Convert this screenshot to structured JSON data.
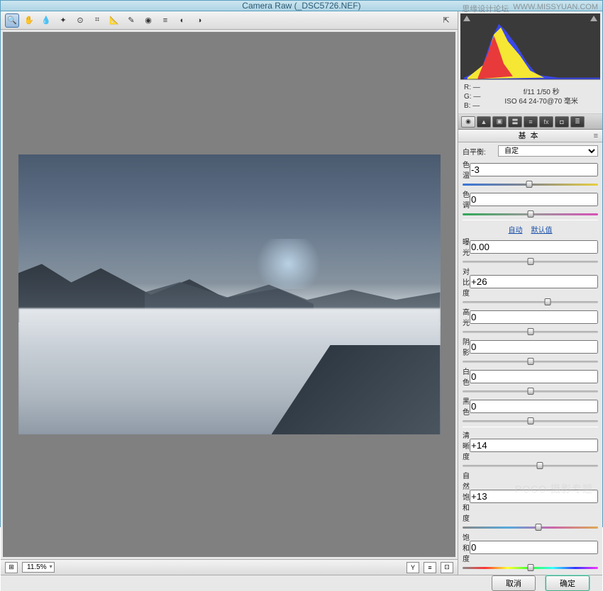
{
  "window": {
    "title": "Camera Raw (_DSC5726.NEF)"
  },
  "watermark": {
    "left": "思缘设计论坛",
    "right": "WWW.MISSYUAN.COM",
    "poco": "POCO 摄影专题"
  },
  "toolbar": {
    "icons": [
      "zoom",
      "hand",
      "eyedrop-wb",
      "eyedrop-color",
      "target",
      "crop",
      "straighten",
      "retouch",
      "redeye",
      "prefs",
      "rotate-ccw",
      "rotate-cw",
      "toggle"
    ]
  },
  "status": {
    "zoom_label": "11.5%",
    "left_icon": "⊞",
    "right_icons": [
      "Y",
      "≡",
      "⊡"
    ]
  },
  "meta": {
    "rgb_labels": [
      "R:",
      "G:",
      "B:"
    ],
    "rgb_vals": [
      "—",
      "—",
      "—"
    ],
    "aperture_shutter": "f/11  1/50 秒",
    "iso_lens": "ISO 64  24-70@70 毫米"
  },
  "panel": {
    "tabs": [
      "◉",
      "▲",
      "▣",
      "〓",
      "≡",
      "fx",
      "◘",
      "≣"
    ],
    "title": "基本",
    "wb_label": "白平衡:",
    "wb_value": "自定",
    "auto_label": "自动",
    "default_label": "默认值",
    "sliders": {
      "temp": {
        "label": "色温",
        "value": "-3",
        "pos": 49
      },
      "tint": {
        "label": "色调",
        "value": "0",
        "pos": 50
      },
      "exposure": {
        "label": "曝光",
        "value": "0.00",
        "pos": 50
      },
      "contrast": {
        "label": "对比度",
        "value": "+26",
        "pos": 63
      },
      "highlights": {
        "label": "高光",
        "value": "0",
        "pos": 50
      },
      "shadows": {
        "label": "阴影",
        "value": "0",
        "pos": 50
      },
      "whites": {
        "label": "白色",
        "value": "0",
        "pos": 50
      },
      "blacks": {
        "label": "黑色",
        "value": "0",
        "pos": 50
      },
      "clarity": {
        "label": "清晰度",
        "value": "+14",
        "pos": 57
      },
      "vibrance": {
        "label": "自然饱和度",
        "value": "+13",
        "pos": 56
      },
      "saturation": {
        "label": "饱和度",
        "value": "0",
        "pos": 50
      }
    }
  },
  "footer": {
    "cancel": "取消",
    "ok": "确定"
  }
}
